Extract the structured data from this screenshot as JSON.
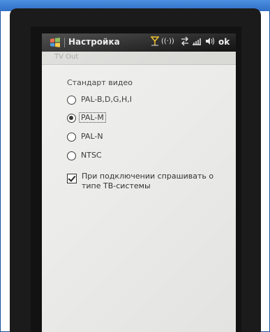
{
  "titlebar": {
    "app_title": "Настройка",
    "ok_label": "ok",
    "status_icons": [
      "antenna-icon",
      "wireless-icon",
      "sync-icon",
      "signal-icon",
      "volume-icon"
    ]
  },
  "caption": {
    "text": "TV Out"
  },
  "video_standard": {
    "label": "Стандарт видео",
    "options": [
      {
        "label": "PAL-B,D,G,H,I",
        "selected": false
      },
      {
        "label": "PAL-M",
        "selected": true
      },
      {
        "label": "PAL-N",
        "selected": false
      },
      {
        "label": "NTSC",
        "selected": false
      }
    ]
  },
  "ask_checkbox": {
    "label": "При подключении спрашивать о типе ТВ-системы",
    "checked": true
  },
  "colors": {
    "titlebar": "#1e1e1e",
    "screen": "#ececea",
    "top_band": "#3c7fd6"
  }
}
